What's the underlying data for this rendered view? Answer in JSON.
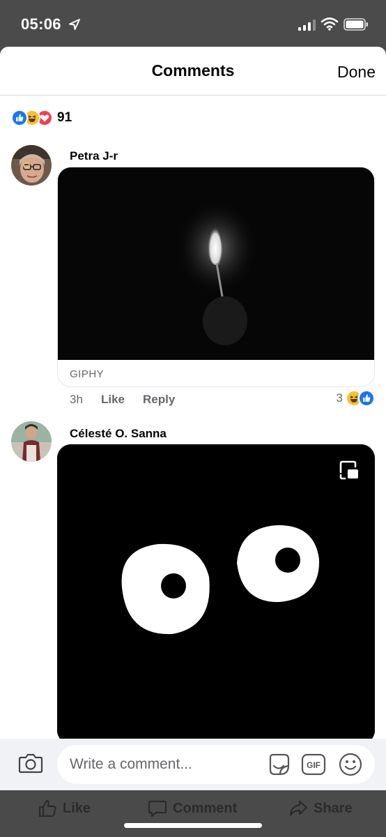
{
  "status_bar": {
    "time": "05:06",
    "icons": [
      "location-arrow-icon",
      "signal-icon",
      "wifi-icon",
      "battery-icon"
    ]
  },
  "sheet": {
    "title": "Comments",
    "done_label": "Done"
  },
  "reactions_summary": {
    "icons": [
      "like-reaction-icon",
      "haha-reaction-icon",
      "love-reaction-icon"
    ],
    "count": "91"
  },
  "comments": [
    {
      "author": "Petra J-r",
      "attachment_label": "GIPHY",
      "time": "3h",
      "like_label": "Like",
      "reply_label": "Reply",
      "reaction_count": "3"
    },
    {
      "author": "Célesté O. Sanna"
    }
  ],
  "composer": {
    "placeholder": "Write a comment...",
    "gif_label": "GIF"
  },
  "action_bar": {
    "like_label": "Like",
    "comment_label": "Comment",
    "share_label": "Share"
  },
  "colors": {
    "like_blue": "#1877f2",
    "haha_yellow": "#f7c12f",
    "love_red": "#f33e58",
    "secondary_text": "#65676b"
  }
}
